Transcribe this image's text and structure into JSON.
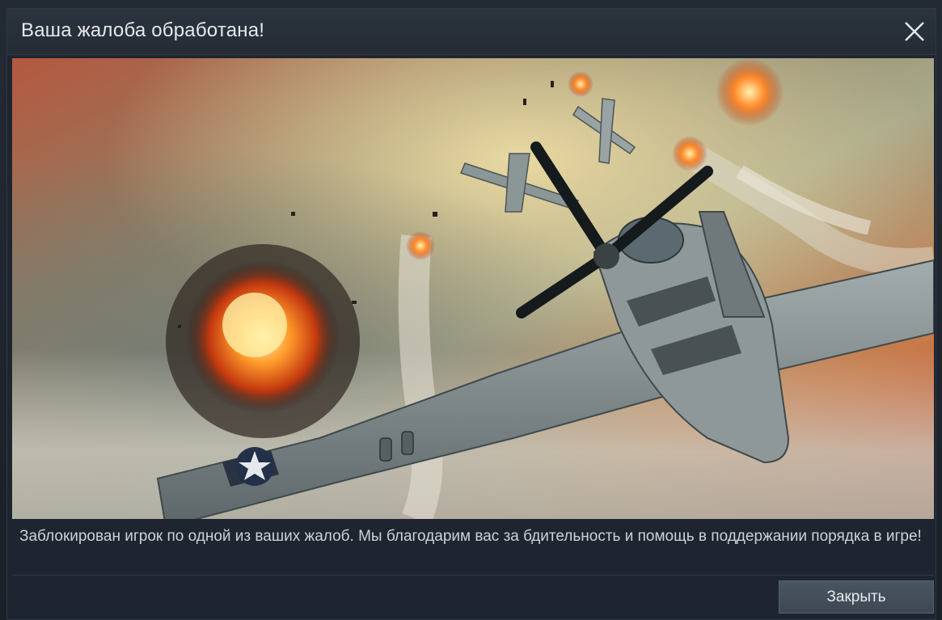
{
  "dialog": {
    "title": "Ваша жалоба обработана!",
    "message": "Заблокирован игрок по одной из ваших жалоб. Мы благодарим вас за бдительность и помощь в поддержании порядка в игре!",
    "close_button_label": "Закрыть",
    "close_icon": "close-icon",
    "illustration": "dogfight-warplanes-illustration"
  },
  "colors": {
    "background": "#1e2530",
    "header": "#28303a",
    "button": "#445060",
    "text": "#e6e9ec"
  }
}
